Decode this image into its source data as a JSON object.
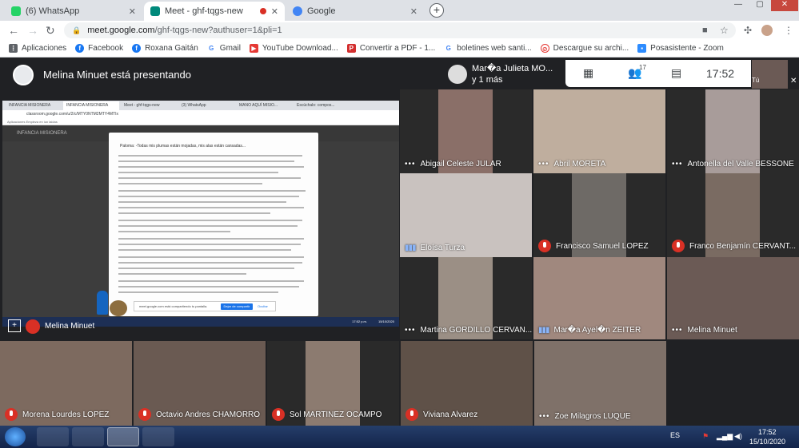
{
  "browser": {
    "tabs": [
      {
        "title": "(6) WhatsApp",
        "icon": "whatsapp-icon",
        "color": "#25d366"
      },
      {
        "title": "Meet - ghf-tqgs-new",
        "icon": "meet-icon",
        "color": "#00897b"
      },
      {
        "title": "Google",
        "icon": "google-icon",
        "color": "#4285f4"
      }
    ],
    "window_controls": {
      "minimize": "—",
      "maximize": "▢",
      "close": "✕"
    },
    "url_host": "meet.google.com",
    "url_path": "/ghf-tqgs-new?authuser=1&pli=1",
    "bookmarks": [
      {
        "label": "Aplicaciones",
        "icon": "apps-grid-icon",
        "color": "#5f6368"
      },
      {
        "label": "Facebook",
        "icon": "facebook-icon",
        "color": "#1877f2"
      },
      {
        "label": "Roxana Gaitán",
        "icon": "facebook-icon",
        "color": "#1877f2"
      },
      {
        "label": "Gmail",
        "icon": "google-icon",
        "color": "#4285f4"
      },
      {
        "label": "YouTube Download...",
        "icon": "youtube-icon",
        "color": "#e53935"
      },
      {
        "label": "Convertir a PDF - 1...",
        "icon": "pdf-icon",
        "color": "#d32f2f"
      },
      {
        "label": "boletines web santi...",
        "icon": "google-icon",
        "color": "#4285f4"
      },
      {
        "label": "Descargue su archi...",
        "icon": "download-icon",
        "color": "#e53935"
      },
      {
        "label": "Posasistente - Zoom",
        "icon": "zoom-icon",
        "color": "#2d8cff"
      }
    ]
  },
  "meet": {
    "presenter_text": "Melina Minuet está presentando",
    "presenter_tile_name": "Melina Minuet",
    "header_name": "Mar�a Julieta MO...",
    "header_more": "y 1 más",
    "participants_count": "17",
    "clock": "17:52",
    "self_label": "Tú",
    "shared": {
      "tabs": [
        "INFANCIA MISIONERA",
        "INFANCIA MISIONERA",
        "Meet - ghf-tqgs-new",
        "(3) WhatsApp",
        "MANO AQUÍ MISIO...",
        "Escúchalo: compos..."
      ],
      "url": "classroom.google.com/u/2/c/MTY0NTM2MTY4MTIx",
      "bookmarks": "Aplicaciones   Empieza en iun laidas",
      "appbar_title": "INFANCIA MISIONERA",
      "doc_title": "Paloma: -Todas mis plumas están mojadas, mis alas están cansadas...",
      "share_notice": "meet.google.com está compartiendo tu pantalla.",
      "stop_label": "Dejar de compartir",
      "hide_label": "Ocultar",
      "taskbar_time": "17:52 p.m.",
      "taskbar_date": "15/10/2020"
    },
    "tiles": [
      {
        "name": "Abigail Celeste JULAR",
        "status": "dots",
        "color": "#8a6f68"
      },
      {
        "name": "Abril MORETA",
        "status": "dots",
        "color": "#bfae9e"
      },
      {
        "name": "Antonella del Valle BESSONE",
        "status": "dots",
        "color": "#a89c9a"
      },
      {
        "name": "Eloísa Turza",
        "status": "wave",
        "color": "#c9c2bf"
      },
      {
        "name": "Francisco Samuel LOPEZ",
        "status": "muted",
        "color": "#6e6a66"
      },
      {
        "name": "Franco Benjamín CERVANT...",
        "status": "muted",
        "color": "#7a6b62"
      },
      {
        "name": "Martina GORDILLO CERVAN...",
        "status": "dots",
        "color": "#9b8f85"
      },
      {
        "name": "Mar�a Ayel�n ZEITER",
        "status": "wave",
        "color": "#a0887e"
      },
      {
        "name": "Melina Minuet",
        "status": "dots",
        "color": "#6b5a55"
      },
      {
        "name": "Morena Lourdes LOPEZ",
        "status": "muted",
        "color": "#7d6a5f"
      },
      {
        "name": "Octavio Andres CHAMORRO",
        "status": "muted",
        "color": "#6a5a52"
      },
      {
        "name": "Sol MARTINEZ OCAMPO",
        "status": "muted",
        "color": "#8c7b70"
      },
      {
        "name": "Viviana Alvarez",
        "status": "muted",
        "color": "#5f5148"
      },
      {
        "name": "Zoe Milagros LUQUE",
        "status": "dots",
        "color": "#7f7169"
      }
    ]
  },
  "taskbar": {
    "language": "ES",
    "time": "17:52",
    "date": "15/10/2020"
  }
}
